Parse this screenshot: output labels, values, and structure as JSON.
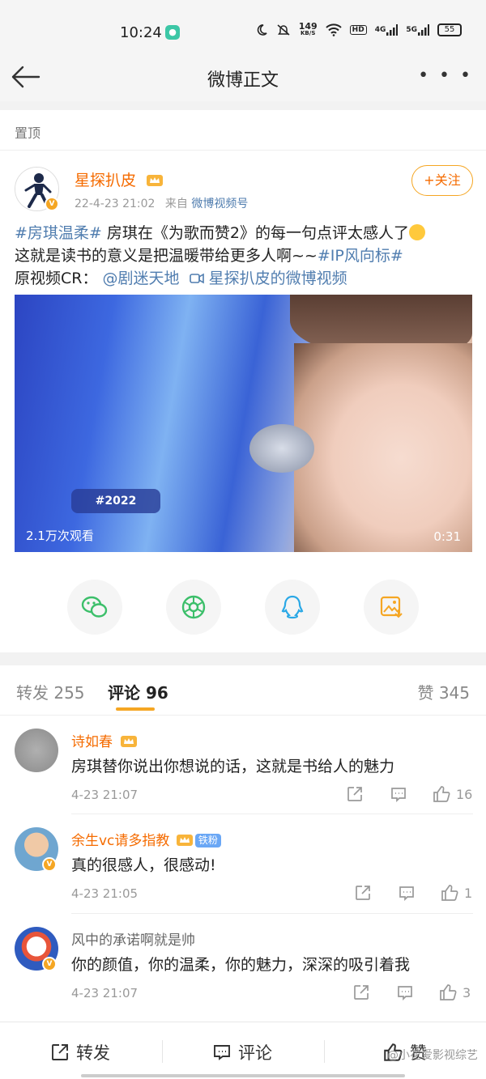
{
  "status_bar": {
    "time": "10:24",
    "network_speed": "149",
    "network_unit": "KB/S",
    "hd_label": "HD",
    "sim1": "4G",
    "sim2": "5G",
    "battery": "55"
  },
  "nav": {
    "title": "微博正文",
    "more": "• • •"
  },
  "pinned_label": "置顶",
  "post": {
    "author": "星探扒皮",
    "date": "22-4-23 21:02",
    "source_prefix": "来自",
    "source": "微博视频号",
    "follow_label": "+关注",
    "tag1": "#房琪温柔#",
    "text1": " 房琪在《为歌而赞2》的每一句点评太感人了",
    "text2": "这就是读书的意义是把温暖带给更多人啊~~",
    "tag2": "#IP风向标#",
    "text3": "原视频CR：",
    "mention": "@剧迷天地",
    "video_link": "星探扒皮的微博视频",
    "video": {
      "caption_label": "#2022",
      "views": "2.1万次观看",
      "duration": "0:31"
    }
  },
  "share_icons": [
    "wechat-icon",
    "moments-icon",
    "qq-icon",
    "save-image-icon"
  ],
  "tabs": {
    "repost": "转发 255",
    "comment": "评论 96",
    "like": "赞 345"
  },
  "comments": [
    {
      "name": "诗如春",
      "text": "房琪替你说出你想说的话，这就是书给人的魅力",
      "time": "4-23 21:07",
      "likes": "16"
    },
    {
      "name": "余生vc请多指教",
      "fan_badge": "铁粉",
      "text": "真的很感人，很感动!",
      "time": "4-23 21:05",
      "likes": "1"
    },
    {
      "name": "风中的承诺啊就是帅",
      "text": "你的颜值，你的温柔，你的魅力，深深的吸引着我",
      "time": "4-23 21:07",
      "likes": "3"
    }
  ],
  "bottom_bar": {
    "repost": "转发",
    "comment": "评论",
    "like": "赞",
    "watermark": "@小花爱影视综艺"
  },
  "colors": {
    "accent_orange": "#f56b00",
    "link_blue": "#507daf",
    "tab_underline": "#f5a623"
  }
}
